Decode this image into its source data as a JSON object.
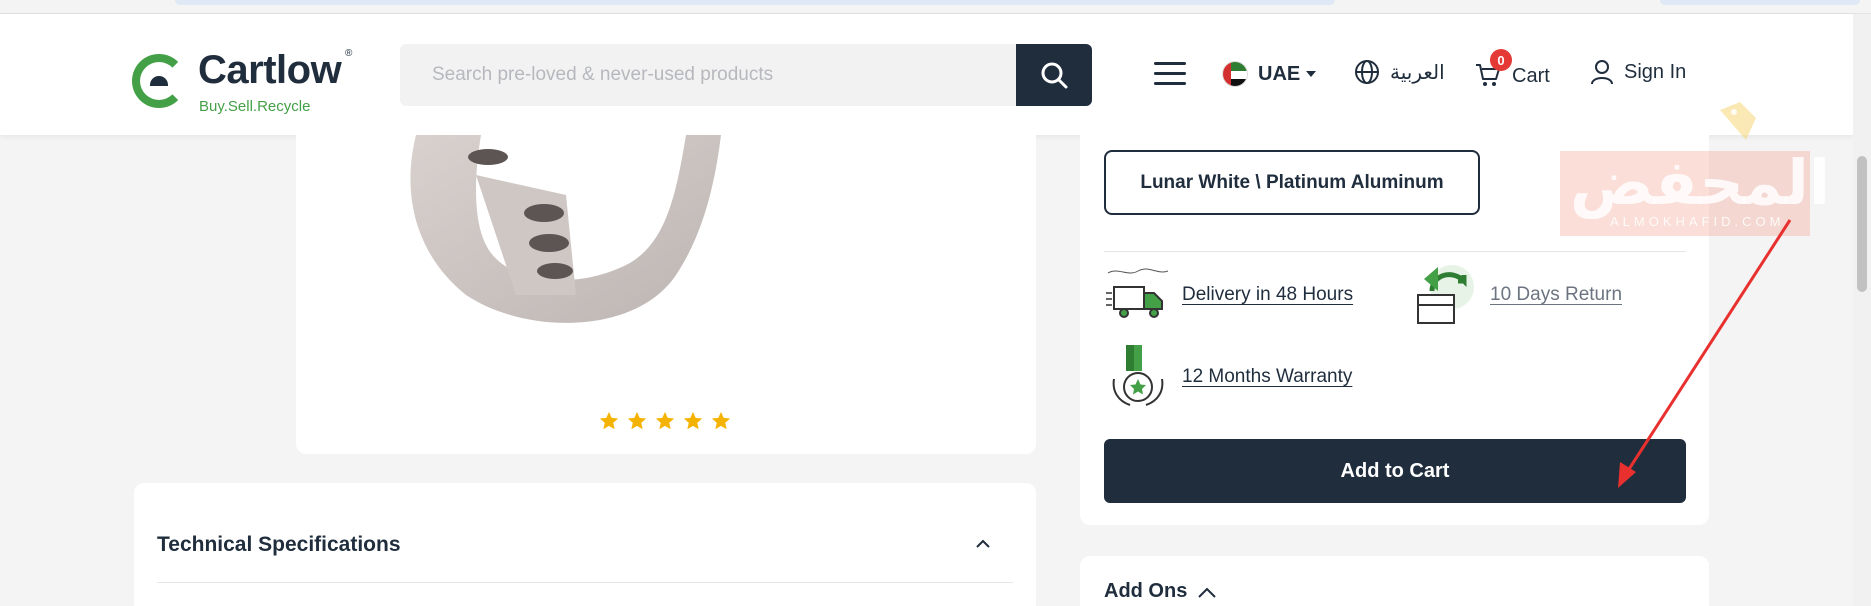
{
  "header": {
    "logo_name": "Cartlow",
    "logo_reg": "®",
    "logo_tagline": "Buy.Sell.Recycle",
    "search_placeholder": "Search pre-loved & never-used products",
    "country_label": "UAE",
    "language_label": "العربية",
    "cart_label": "Cart",
    "cart_count": "0",
    "signin_label": "Sign In"
  },
  "product": {
    "rating_stars": 5
  },
  "buy_panel": {
    "variant_label": "Lunar White \\ Platinum Aluminum",
    "features": [
      {
        "label": "Delivery in 48 Hours",
        "icon": "delivery-truck-icon"
      },
      {
        "label": "10 Days Return",
        "icon": "return-box-icon"
      },
      {
        "label": "12 Months Warranty",
        "icon": "warranty-medal-icon"
      }
    ],
    "add_to_cart_label": "Add to Cart"
  },
  "specs": {
    "title": "Technical Specifications"
  },
  "addons": {
    "title": "Add Ons"
  },
  "watermark": {
    "text": "المحفض",
    "subtext": "ALMOKHAFID.COM"
  },
  "colors": {
    "brand_dark": "#1f2d3d",
    "brand_green": "#43a047",
    "badge_red": "#e53935",
    "star_yellow": "#f5b301",
    "annotation_red": "#e8312f"
  }
}
